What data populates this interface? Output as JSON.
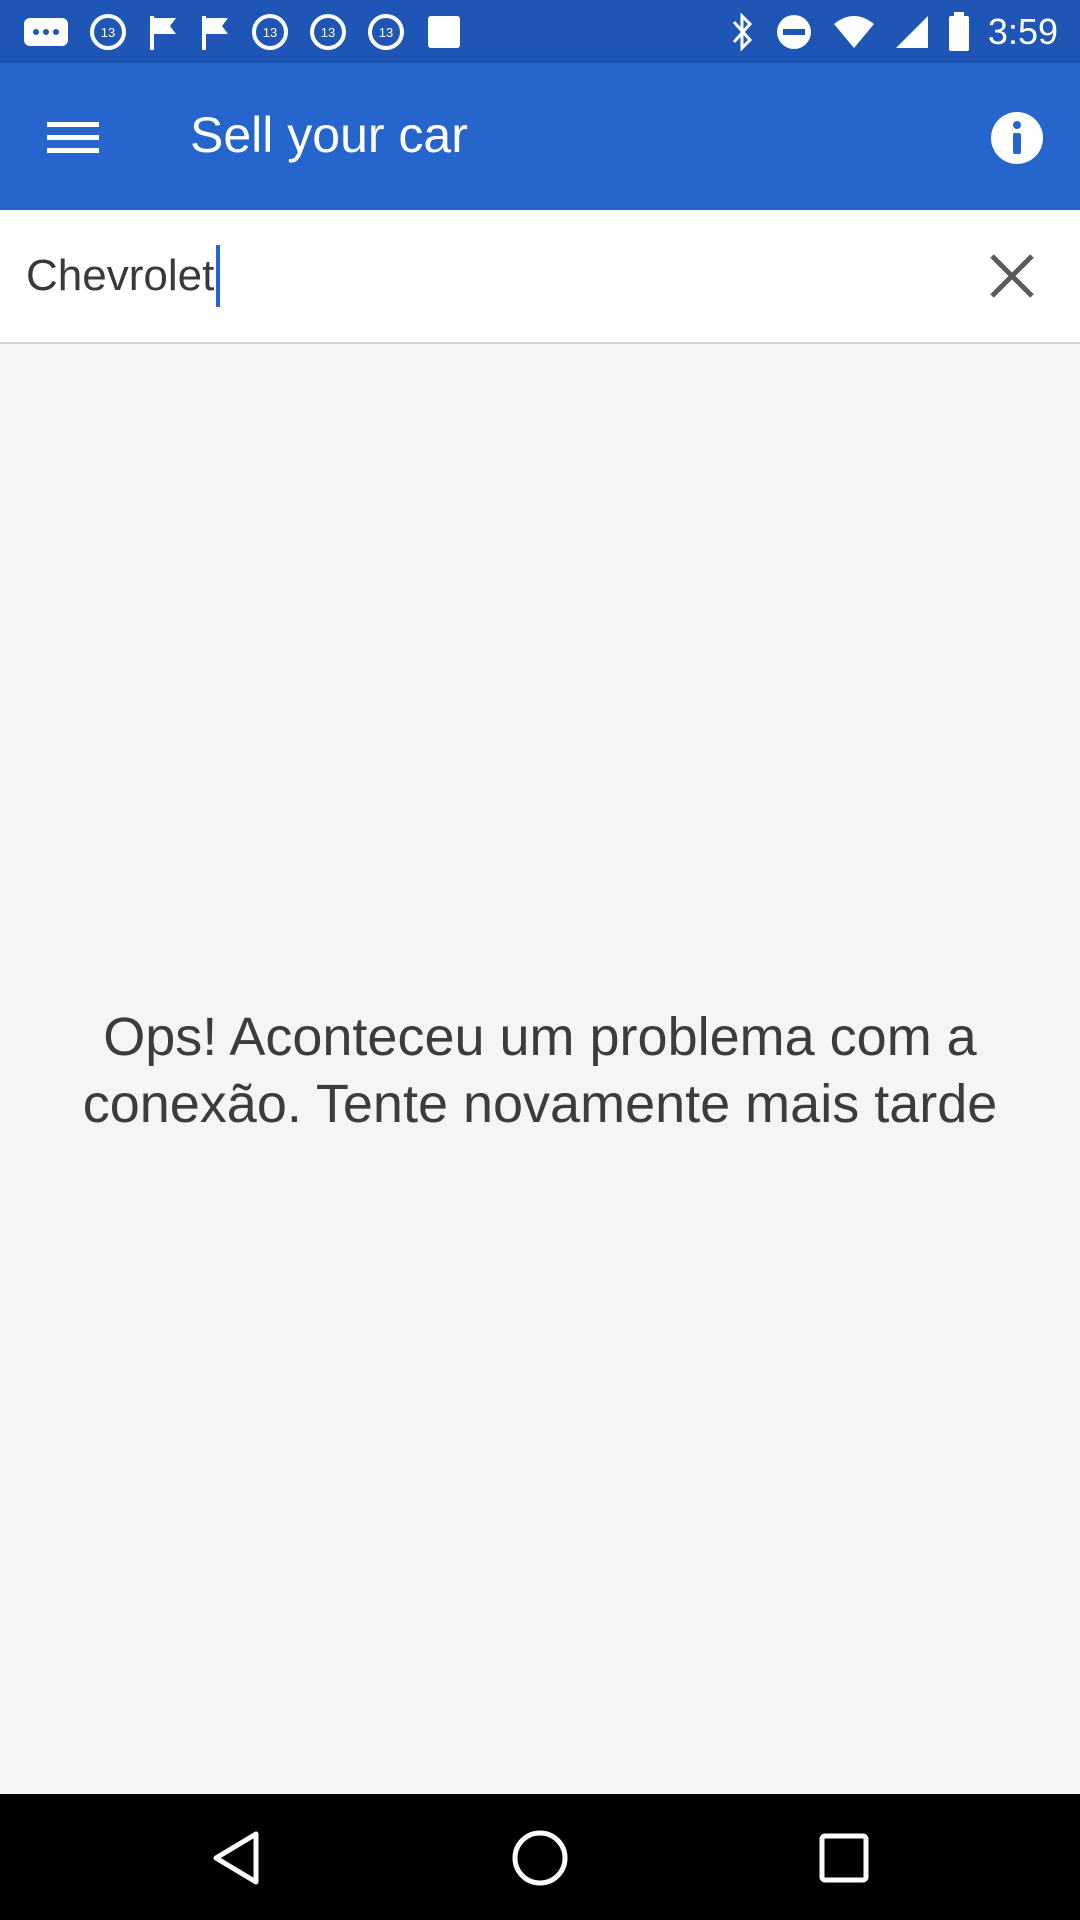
{
  "status_bar": {
    "time": "3:59",
    "left_icons": [
      "more-notifications-icon",
      "abc13-notification-icon",
      "flag-notification-icon",
      "flag-notification-icon",
      "abc13-notification-icon",
      "abc13-notification-icon",
      "abc13-notification-icon",
      "stop-notification-icon"
    ],
    "right_icons": [
      "bluetooth-icon",
      "do-not-disturb-icon",
      "wifi-icon",
      "signal-icon",
      "battery-icon"
    ]
  },
  "app_bar": {
    "title": "Sell your car",
    "menu_icon": "menu-icon",
    "info_icon": "info-icon"
  },
  "search": {
    "value": "Chevrolet",
    "clear_icon": "close-icon"
  },
  "main": {
    "message": "Ops! Aconteceu um problema com a conexão. Tente novamente mais tarde"
  },
  "nav_bar": {
    "back_icon": "back-icon",
    "home_icon": "home-icon",
    "recents_icon": "recents-icon"
  },
  "colors": {
    "status_bar": "#1f56b5",
    "app_bar": "#2565cc",
    "background": "#f5f5f5",
    "nav_bar": "#000000"
  }
}
